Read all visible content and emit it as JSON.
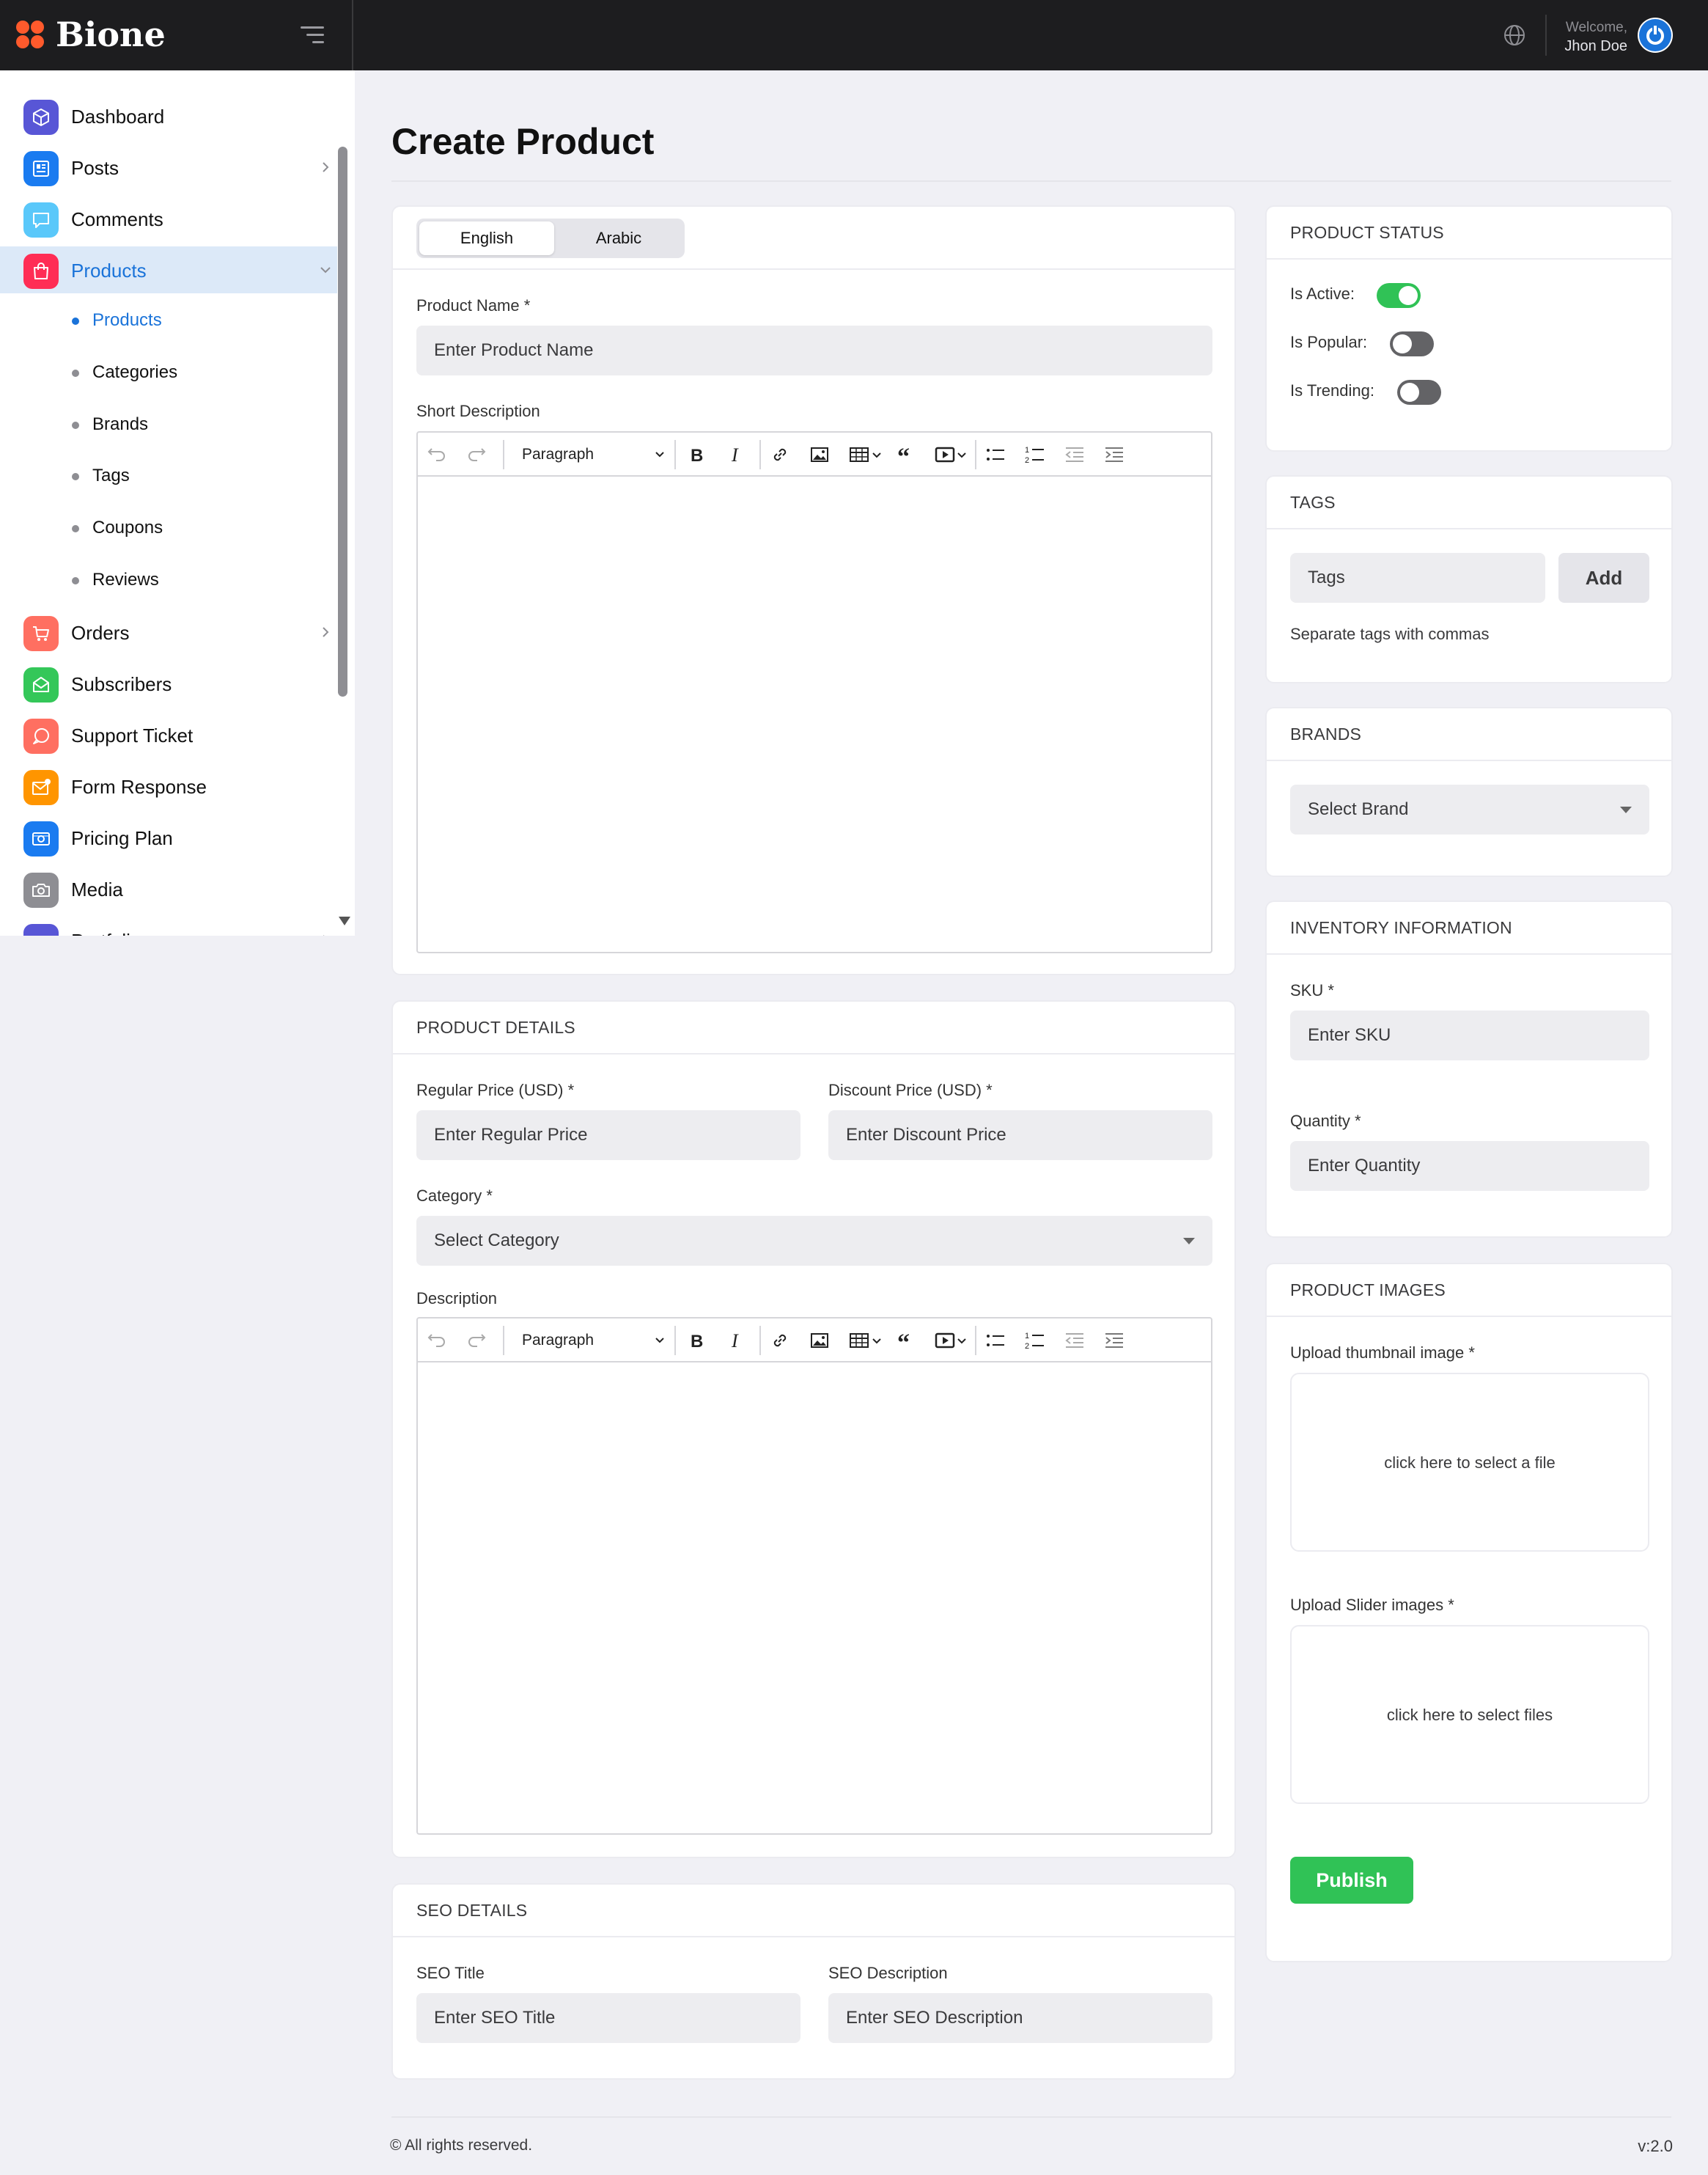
{
  "app": {
    "name": "Bione"
  },
  "header": {
    "welcome": "Welcome,",
    "user_name": "Jhon Doe"
  },
  "sidebar": {
    "items": [
      {
        "label": "Dashboard",
        "icon": "cube-icon",
        "color": "#5856d6"
      },
      {
        "label": "Posts",
        "icon": "newspaper-icon",
        "color": "#1a7bf0"
      },
      {
        "label": "Comments",
        "icon": "chat-bubble-icon",
        "color": "#5ac8fa"
      },
      {
        "label": "Products",
        "icon": "shopping-bag-icon",
        "color": "#ff2d55",
        "active": true
      },
      {
        "label": "Orders",
        "icon": "cart-icon",
        "color": "#ff6f61"
      },
      {
        "label": "Subscribers",
        "icon": "envelope-icon",
        "color": "#34c759"
      },
      {
        "label": "Support Ticket",
        "icon": "support-chat-icon",
        "color": "#ff6f61"
      },
      {
        "label": "Form Response",
        "icon": "mail-badge-icon",
        "color": "#ff9500"
      },
      {
        "label": "Pricing Plan",
        "icon": "money-icon",
        "color": "#1a7bf0"
      },
      {
        "label": "Media",
        "icon": "camera-icon",
        "color": "#8e8e93"
      },
      {
        "label": "Portfolio",
        "icon": "folder-icon",
        "color": "#5856d6"
      }
    ],
    "products_sub": [
      {
        "label": "Products",
        "active": true
      },
      {
        "label": "Categories"
      },
      {
        "label": "Brands"
      },
      {
        "label": "Tags"
      },
      {
        "label": "Coupons"
      },
      {
        "label": "Reviews"
      }
    ]
  },
  "page": {
    "title": "Create Product"
  },
  "basic": {
    "tabs": [
      "English",
      "Arabic"
    ],
    "active_tab": "English",
    "product_name_label": "Product Name *",
    "product_name_placeholder": "Enter Product Name",
    "short_description_label": "Short Description",
    "paragraph": "Paragraph"
  },
  "details": {
    "title": "PRODUCT DETAILS",
    "regular_price_label": "Regular Price (USD) *",
    "regular_price_placeholder": "Enter Regular Price",
    "discount_price_label": "Discount Price (USD) *",
    "discount_price_placeholder": "Enter Discount Price",
    "category_label": "Category *",
    "category_value": "Select Category",
    "description_label": "Description",
    "paragraph": "Paragraph"
  },
  "seo": {
    "title": "SEO DETAILS",
    "seo_title_label": "SEO Title",
    "seo_title_placeholder": "Enter SEO Title",
    "seo_description_label": "SEO Description",
    "seo_description_placeholder": "Enter SEO Description"
  },
  "status": {
    "title": "PRODUCT STATUS",
    "is_active_label": "Is Active:",
    "is_active": true,
    "is_popular_label": "Is Popular:",
    "is_popular": false,
    "is_trending_label": "Is Trending:",
    "is_trending": false
  },
  "tags": {
    "title": "TAGS",
    "placeholder": "Tags",
    "add_label": "Add",
    "hint": "Separate tags with commas"
  },
  "brands": {
    "title": "BRANDS",
    "value": "Select Brand"
  },
  "inventory": {
    "title": "INVENTORY INFORMATION",
    "sku_label": "SKU *",
    "sku_placeholder": "Enter SKU",
    "quantity_label": "Quantity *",
    "quantity_placeholder": "Enter Quantity"
  },
  "images": {
    "title": "PRODUCT IMAGES",
    "thumbnail_label": "Upload thumbnail image *",
    "thumbnail_hint": "click here to select a file",
    "slider_label": "Upload Slider images *",
    "slider_hint": "click here to select files",
    "publish_label": "Publish"
  },
  "footer": {
    "copyright": "© All rights reserved.",
    "version": "v:2.0"
  },
  "colors": {
    "accent": "#1a73d9",
    "success": "#30c256",
    "topbar": "#1d1d1f"
  }
}
